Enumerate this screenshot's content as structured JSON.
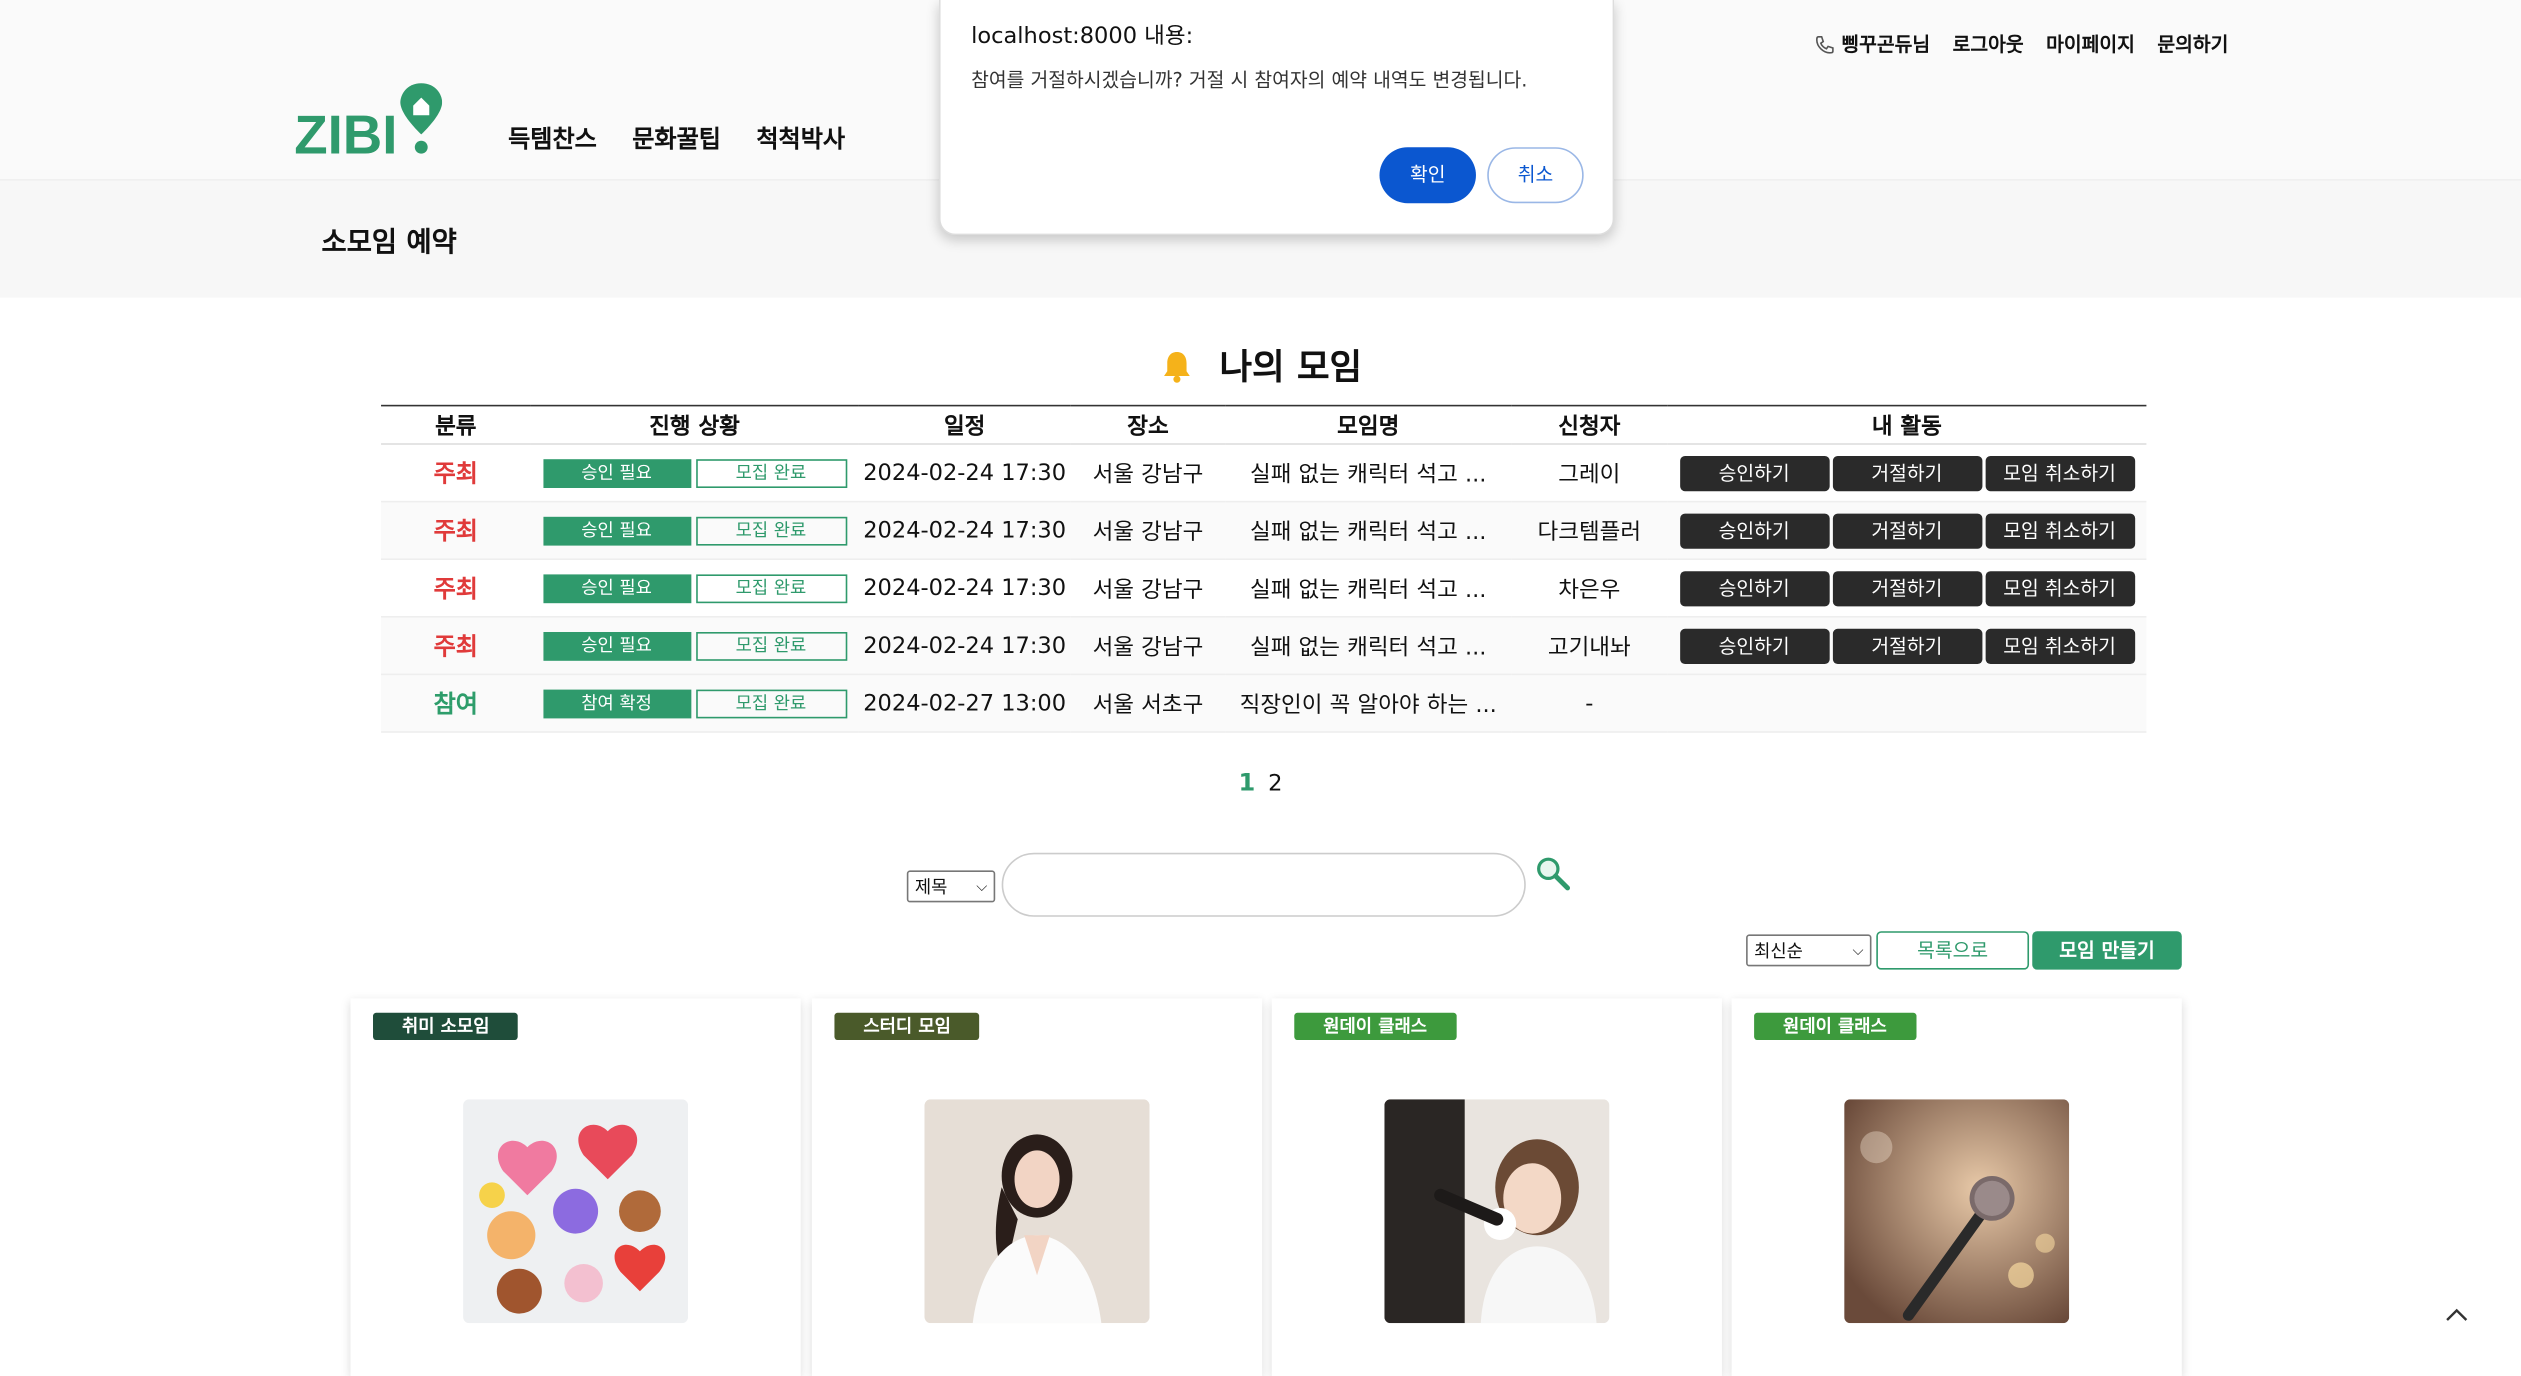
{
  "nav": {
    "items": [
      "득템찬스",
      "문화꿀팁",
      "척척박사"
    ]
  },
  "util": {
    "user": "삥꾸곤듀님",
    "logout": "로그아웃",
    "mypage": "마이페이지",
    "contact": "문의하기"
  },
  "banner": {
    "title": "소모임 예약"
  },
  "section": {
    "title": "나의 모임"
  },
  "table": {
    "headers": [
      "분류",
      "진행 상황",
      "일정",
      "장소",
      "모임명",
      "신청자",
      "내 활동"
    ],
    "rows": [
      {
        "category": "주최",
        "status1": "승인 필요",
        "status2": "모집 완료",
        "date": "2024-02-24 17:30",
        "place": "서울 강남구",
        "name": "실패 없는 캐릭터 석고 ...",
        "applicant": "그레이"
      },
      {
        "category": "주최",
        "status1": "승인 필요",
        "status2": "모집 완료",
        "date": "2024-02-24 17:30",
        "place": "서울 강남구",
        "name": "실패 없는 캐릭터 석고 ...",
        "applicant": "다크템플러"
      },
      {
        "category": "주최",
        "status1": "승인 필요",
        "status2": "모집 완료",
        "date": "2024-02-24 17:30",
        "place": "서울 강남구",
        "name": "실패 없는 캐릭터 석고 ...",
        "applicant": "차은우"
      },
      {
        "category": "주최",
        "status1": "승인 필요",
        "status2": "모집 완료",
        "date": "2024-02-24 17:30",
        "place": "서울 강남구",
        "name": "실패 없는 캐릭터 석고 ...",
        "applicant": "고기내놔"
      },
      {
        "category": "참여",
        "status1": "참여 확정",
        "status2": "모집 완료",
        "date": "2024-02-27 13:00",
        "place": "서울 서초구",
        "name": "직장인이 꼭 알아야 하는 ...",
        "applicant": "-"
      }
    ],
    "actions": {
      "approve": "승인하기",
      "reject": "거절하기",
      "cancel": "모임 취소하기"
    }
  },
  "pager": {
    "pages": [
      "1",
      "2"
    ],
    "current": "1"
  },
  "search": {
    "select": "제목",
    "value": ""
  },
  "list": {
    "sort": "최신순",
    "list_btn": "목록으로",
    "make_btn": "모임 만들기"
  },
  "cards": [
    {
      "tag": "취미 소모임",
      "tag_color": "#1f4d3a"
    },
    {
      "tag": "스터디 모임",
      "tag_color": "#4a5a2a"
    },
    {
      "tag": "원데이 클래스",
      "tag_color": "#3d9a3d"
    },
    {
      "tag": "원데이 클래스",
      "tag_color": "#3d9a3d"
    }
  ],
  "dialog": {
    "title": "localhost:8000 내용:",
    "message": "참여를 거절하시겠습니까? 거절 시 참여자의 예약 내역도 변경됩니다.",
    "ok": "확인",
    "cancel": "취소"
  },
  "colors": {
    "accent": "#2f9a6c",
    "host": "#e03a3a",
    "dialog_ok": "#0b57d0"
  }
}
